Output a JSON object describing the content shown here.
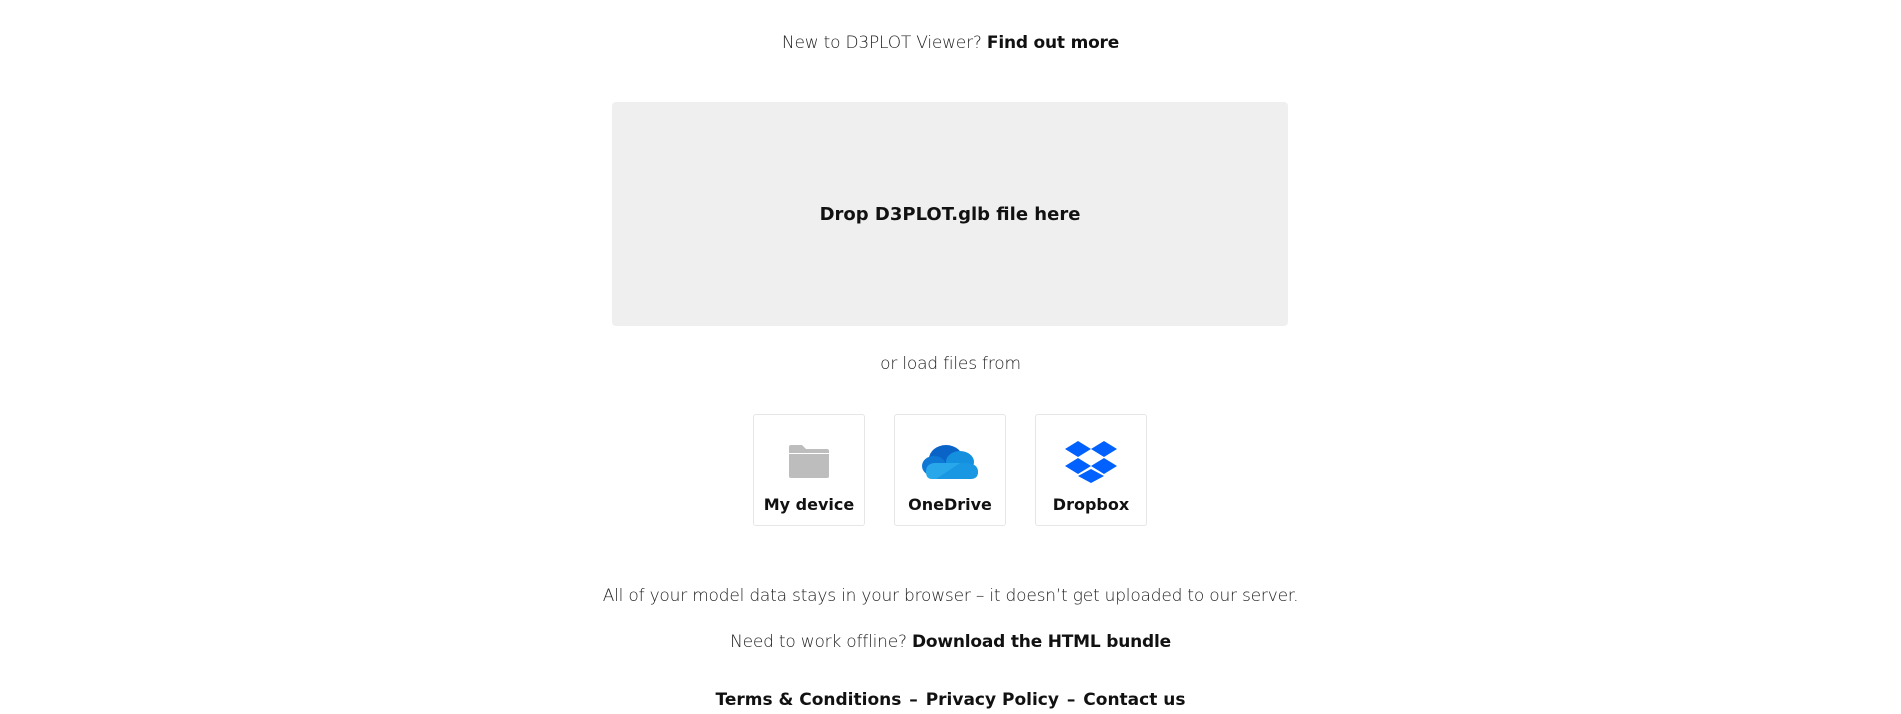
{
  "intro": {
    "text": "New to D3PLOT Viewer?",
    "link": "Find out more"
  },
  "dropzone": {
    "label": "Drop D3PLOT.glb file here"
  },
  "load_from": {
    "text": "or load files from",
    "sources": [
      {
        "label": "My device",
        "icon": "folder-icon"
      },
      {
        "label": "OneDrive",
        "icon": "onedrive-icon"
      },
      {
        "label": "Dropbox",
        "icon": "dropbox-icon"
      }
    ]
  },
  "privacy_note": "All of your model data stays in your browser – it doesn’t get uploaded to our server.",
  "offline": {
    "text": "Need to work offline?",
    "link": "Download the HTML bundle"
  },
  "footer": {
    "terms": "Terms & Conditions",
    "privacy": "Privacy Policy",
    "contact": "Contact us",
    "separator": "–"
  },
  "colors": {
    "dropzone_bg": "#efefef",
    "folder_gray": "#bdbdbd",
    "onedrive_blue": "#0a64c8",
    "dropbox_blue": "#0061fe"
  }
}
